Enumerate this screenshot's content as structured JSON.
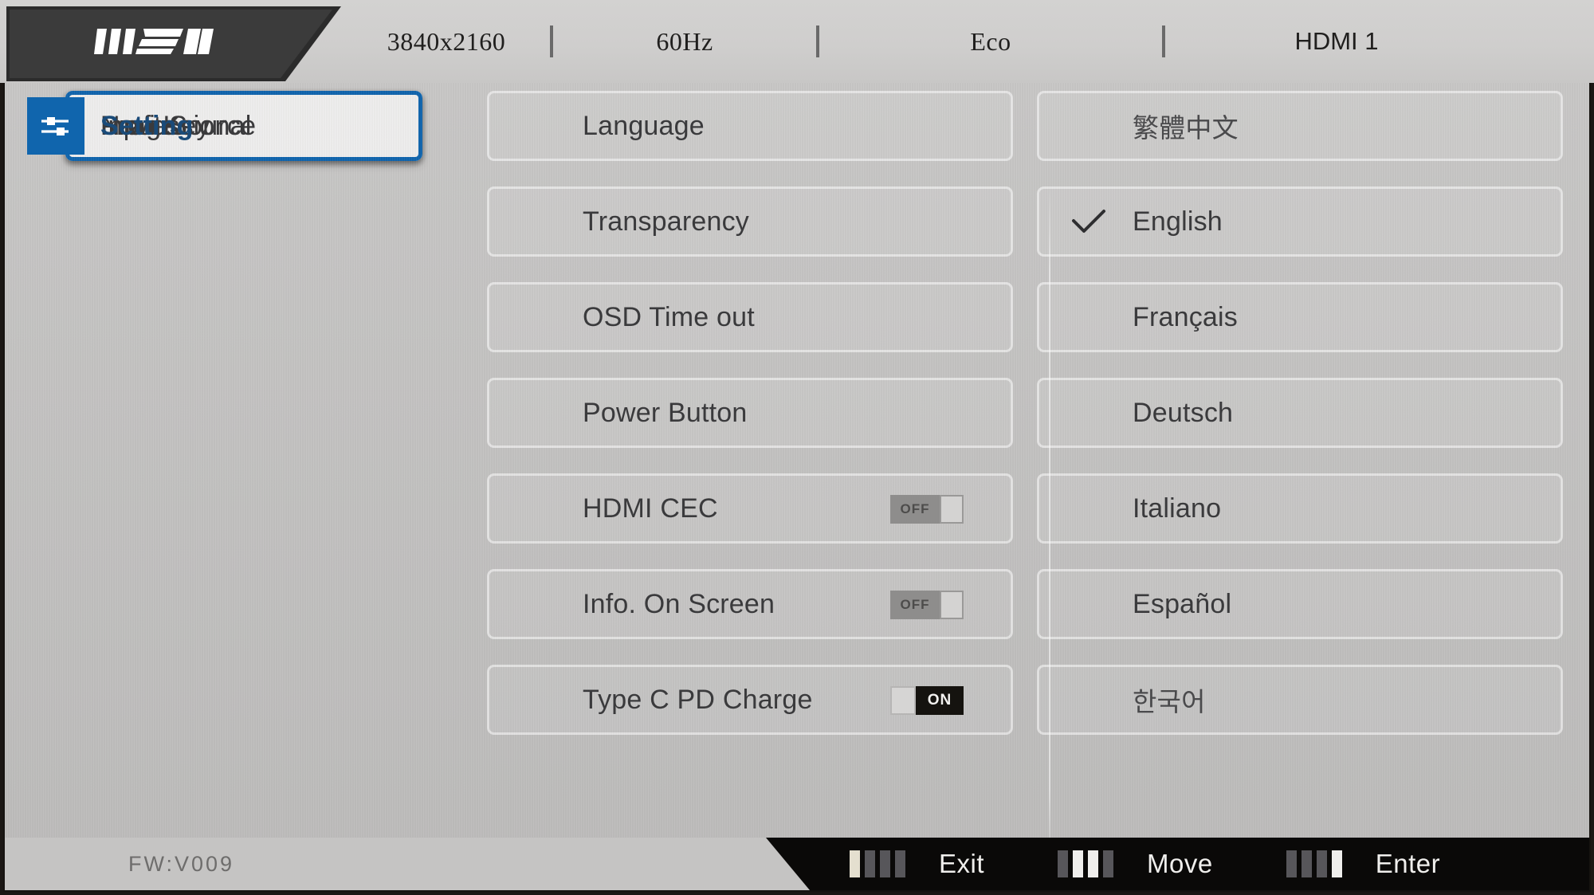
{
  "header": {
    "logo": "msi-logo",
    "resolution": "3840x2160",
    "refresh_rate": "60Hz",
    "mode": "Eco",
    "input": "HDMI 1"
  },
  "sidebar": {
    "items": [
      {
        "label": "Professional",
        "icon": "flag-icon",
        "selected": false
      },
      {
        "label": "Image",
        "icon": "picture-icon",
        "selected": false
      },
      {
        "label": "Input Source",
        "icon": "arrow-right-icon",
        "selected": false
      },
      {
        "label": "Navi Key",
        "icon": "hand-press-icon",
        "selected": false
      },
      {
        "label": "Setting",
        "icon": "sliders-icon",
        "selected": true
      }
    ]
  },
  "settings_menu": {
    "items": [
      {
        "label": "Language",
        "toggle": null
      },
      {
        "label": "Transparency",
        "toggle": null
      },
      {
        "label": "OSD Time out",
        "toggle": null
      },
      {
        "label": "Power Button",
        "toggle": null
      },
      {
        "label": "HDMI CEC",
        "toggle": "OFF"
      },
      {
        "label": "Info. On Screen",
        "toggle": "OFF"
      },
      {
        "label": "Type C PD Charge",
        "toggle": "ON"
      }
    ]
  },
  "language_list": {
    "items": [
      {
        "label": "繁體中文",
        "selected": false
      },
      {
        "label": "English",
        "selected": true
      },
      {
        "label": "Français",
        "selected": false
      },
      {
        "label": "Deutsch",
        "selected": false
      },
      {
        "label": "Italiano",
        "selected": false
      },
      {
        "label": "Español",
        "selected": false
      },
      {
        "label": "한국어",
        "selected": false
      }
    ]
  },
  "footer": {
    "firmware": "FW:V009",
    "actions": [
      {
        "label": "Exit",
        "pattern": [
          "warm",
          "dim",
          "dim",
          "dim"
        ]
      },
      {
        "label": "Move",
        "pattern": [
          "dim",
          "hi",
          "hi",
          "dim"
        ]
      },
      {
        "label": "Enter",
        "pattern": [
          "dim",
          "dim",
          "dim",
          "hi"
        ]
      }
    ]
  },
  "colors": {
    "accent_blue": "#1065ad",
    "panel_gray": "#c5c4c3",
    "bar_dark": "#0a0908",
    "icon_box_gray": "#5a5a5a"
  }
}
